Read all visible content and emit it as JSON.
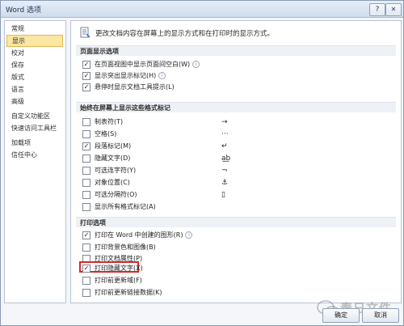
{
  "window": {
    "title": "Word 选项",
    "help_label": "?",
    "close_label": "✕"
  },
  "sidebar": {
    "items": [
      {
        "label": "常规"
      },
      {
        "label": "显示",
        "selected": true
      },
      {
        "label": "校对"
      },
      {
        "label": "保存"
      },
      {
        "label": "版式"
      },
      {
        "label": "语言"
      },
      {
        "label": "高级"
      },
      {
        "label": "自定义功能区"
      },
      {
        "label": "快速访问工具栏"
      },
      {
        "label": "加载项"
      },
      {
        "label": "信任中心"
      }
    ]
  },
  "main": {
    "intro": "更改文档内容在屏幕上的显示方式和在打印时的显示方式。",
    "sections": [
      {
        "title": "页面显示选项",
        "options": [
          {
            "label": "在页面视图中显示页面间空白(W)",
            "checked": true,
            "info": "i"
          },
          {
            "label": "显示突出显示标记(H)",
            "checked": true,
            "info": "i"
          },
          {
            "label": "悬停时显示文档工具提示(L)",
            "checked": true
          }
        ]
      },
      {
        "title": "始终在屏幕上显示这些格式标记",
        "options": [
          {
            "label": "制表符(T)",
            "checked": false,
            "glyph": "→"
          },
          {
            "label": "空格(S)",
            "checked": false,
            "glyph": "···"
          },
          {
            "label": "段落标记(M)",
            "checked": true,
            "glyph": "↵"
          },
          {
            "label": "隐藏文字(D)",
            "checked": false,
            "glyph": "a͟b"
          },
          {
            "label": "可选连字符(Y)",
            "checked": false,
            "glyph": "¬"
          },
          {
            "label": "对象位置(C)",
            "checked": false,
            "glyph": "⚓"
          },
          {
            "label": "可选分隔符(O)",
            "checked": false,
            "glyph": "▯"
          },
          {
            "label": "显示所有格式标记(A)",
            "checked": false
          }
        ]
      },
      {
        "title": "打印选项",
        "options": [
          {
            "label": "打印在 Word 中创建的图形(R)",
            "checked": true,
            "info": "i"
          },
          {
            "label": "打印背景色和图像(B)",
            "checked": false
          },
          {
            "label": "打印文档属性(P)",
            "checked": false
          },
          {
            "label": "打印隐藏文字(X)",
            "checked": true
          },
          {
            "label": "打印前更新域(F)",
            "checked": false
          },
          {
            "label": "打印前更新链接数据(K)",
            "checked": false
          }
        ]
      }
    ]
  },
  "footer": {
    "ok_label": "确定",
    "cancel_label": "取消"
  },
  "watermark": {
    "text": "泰日文件"
  },
  "colors": {
    "selected_bg": "#fbe6a2",
    "highlight_border": "#d12a2a",
    "section_bg": "#eef1f5"
  },
  "icons": {
    "intro": "display-page-icon",
    "watermark": "wechat-logo-icon"
  }
}
